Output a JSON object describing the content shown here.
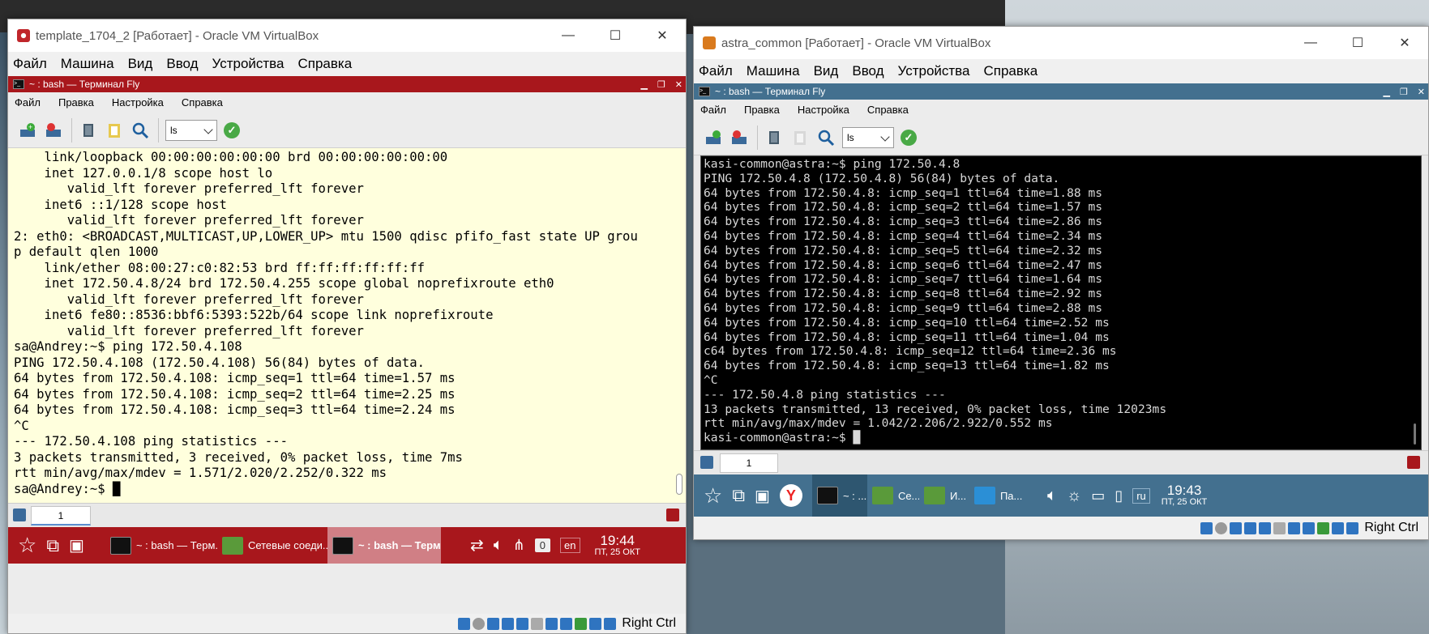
{
  "left_window": {
    "title": "template_1704_2 [Работает] - Oracle VM VirtualBox",
    "menu": [
      "Файл",
      "Машина",
      "Вид",
      "Ввод",
      "Устройства",
      "Справка"
    ],
    "win_buttons": [
      "—",
      "☐",
      "✕"
    ]
  },
  "right_window": {
    "title": "astra_common [Работает] - Oracle VM VirtualBox",
    "menu": [
      "Файл",
      "Машина",
      "Вид",
      "Ввод",
      "Устройства",
      "Справка"
    ],
    "win_buttons": [
      "—",
      "☐",
      "✕"
    ]
  },
  "left_fly": {
    "title": "~ : bash — Терминал Fly",
    "menu": [
      "Файл",
      "Правка",
      "Настройка",
      "Справка"
    ],
    "command": "ls",
    "tab": "1"
  },
  "right_fly": {
    "title": "~ : bash — Терминал Fly",
    "menu": [
      "Файл",
      "Правка",
      "Настройка",
      "Справка"
    ],
    "command": "ls",
    "tab": "1"
  },
  "left_terminal": {
    "lines": [
      "    link/loopback 00:00:00:00:00:00 brd 00:00:00:00:00:00",
      "    inet 127.0.0.1/8 scope host lo",
      "       valid_lft forever preferred_lft forever",
      "    inet6 ::1/128 scope host",
      "       valid_lft forever preferred_lft forever",
      "2: eth0: <BROADCAST,MULTICAST,UP,LOWER_UP> mtu 1500 qdisc pfifo_fast state UP grou",
      "p default qlen 1000",
      "    link/ether 08:00:27:c0:82:53 brd ff:ff:ff:ff:ff:ff",
      "    inet 172.50.4.8/24 brd 172.50.4.255 scope global noprefixroute eth0",
      "       valid_lft forever preferred_lft forever",
      "    inet6 fe80::8536:bbf6:5393:522b/64 scope link noprefixroute",
      "       valid_lft forever preferred_lft forever",
      "sa@Andrey:~$ ping 172.50.4.108",
      "PING 172.50.4.108 (172.50.4.108) 56(84) bytes of data.",
      "64 bytes from 172.50.4.108: icmp_seq=1 ttl=64 time=1.57 ms",
      "64 bytes from 172.50.4.108: icmp_seq=2 ttl=64 time=2.25 ms",
      "64 bytes from 172.50.4.108: icmp_seq=3 ttl=64 time=2.24 ms",
      "^C",
      "--- 172.50.4.108 ping statistics ---",
      "3 packets transmitted, 3 received, 0% packet loss, time 7ms",
      "rtt min/avg/max/mdev = 1.571/2.020/2.252/0.322 ms",
      "sa@Andrey:~$ █"
    ]
  },
  "right_terminal": {
    "lines": [
      "kasi-common@astra:~$ ping 172.50.4.8",
      "PING 172.50.4.8 (172.50.4.8) 56(84) bytes of data.",
      "64 bytes from 172.50.4.8: icmp_seq=1 ttl=64 time=1.88 ms",
      "64 bytes from 172.50.4.8: icmp_seq=2 ttl=64 time=1.57 ms",
      "64 bytes from 172.50.4.8: icmp_seq=3 ttl=64 time=2.86 ms",
      "64 bytes from 172.50.4.8: icmp_seq=4 ttl=64 time=2.34 ms",
      "64 bytes from 172.50.4.8: icmp_seq=5 ttl=64 time=2.32 ms",
      "64 bytes from 172.50.4.8: icmp_seq=6 ttl=64 time=2.47 ms",
      "64 bytes from 172.50.4.8: icmp_seq=7 ttl=64 time=1.64 ms",
      "64 bytes from 172.50.4.8: icmp_seq=8 ttl=64 time=2.92 ms",
      "64 bytes from 172.50.4.8: icmp_seq=9 ttl=64 time=2.88 ms",
      "64 bytes from 172.50.4.8: icmp_seq=10 ttl=64 time=2.52 ms",
      "64 bytes from 172.50.4.8: icmp_seq=11 ttl=64 time=1.04 ms",
      "c64 bytes from 172.50.4.8: icmp_seq=12 ttl=64 time=2.36 ms",
      "64 bytes from 172.50.4.8: icmp_seq=13 ttl=64 time=1.82 ms",
      "^C",
      "--- 172.50.4.8 ping statistics ---",
      "13 packets transmitted, 13 received, 0% packet loss, time 12023ms",
      "rtt min/avg/max/mdev = 1.042/2.206/2.922/0.552 ms",
      "kasi-common@astra:~$ █"
    ]
  },
  "left_taskbar": {
    "items": [
      "~ : bash — Терм...",
      "Сетевые соеди...",
      "~ : bash — Терм..."
    ],
    "badge": "0",
    "lang": "en",
    "time": "19:44",
    "date": "ПТ, 25 ОКТ",
    "host_key": "Right Ctrl"
  },
  "right_taskbar": {
    "items": [
      "~ : ...",
      "Се...",
      "И...",
      "Па..."
    ],
    "lang": "ru",
    "time": "19:43",
    "date": "ПТ, 25 ОКТ",
    "host_key": "Right Ctrl"
  },
  "colors": {
    "left_fly_accent": "#a8171c",
    "right_fly_accent": "#43708f",
    "left_terminal_bg": "#ffffdd",
    "right_terminal_bg": "#000000"
  }
}
